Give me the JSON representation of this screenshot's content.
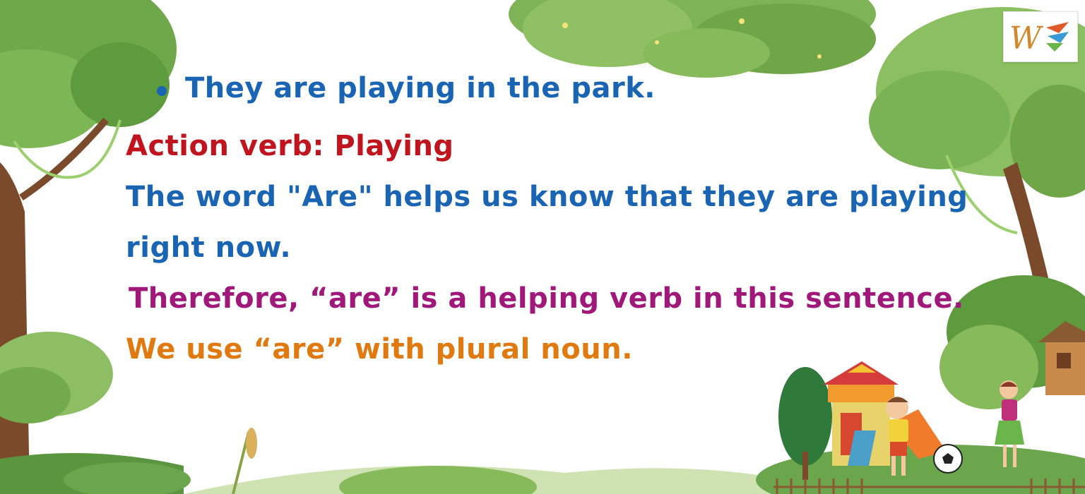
{
  "slide": {
    "sentence": "They are playing in the park.",
    "action_verb": "Action verb: Playing",
    "explanation_line1": "The word \"Are\" helps us know that they are playing",
    "explanation_line2": "right now.",
    "conclusion": "Therefore, “are” is a helping verb in this sentence.",
    "rule": "We use “are” with plural noun."
  },
  "colors": {
    "blue": "#1a64b4",
    "red": "#c0141e",
    "magenta": "#a0197a",
    "orange": "#e07a10",
    "leaf_green": "#6fa84a",
    "trunk_brown": "#7a4a2a"
  },
  "icons": {
    "logo": "w-brand-logo",
    "scene": "park-playground-illustration"
  }
}
